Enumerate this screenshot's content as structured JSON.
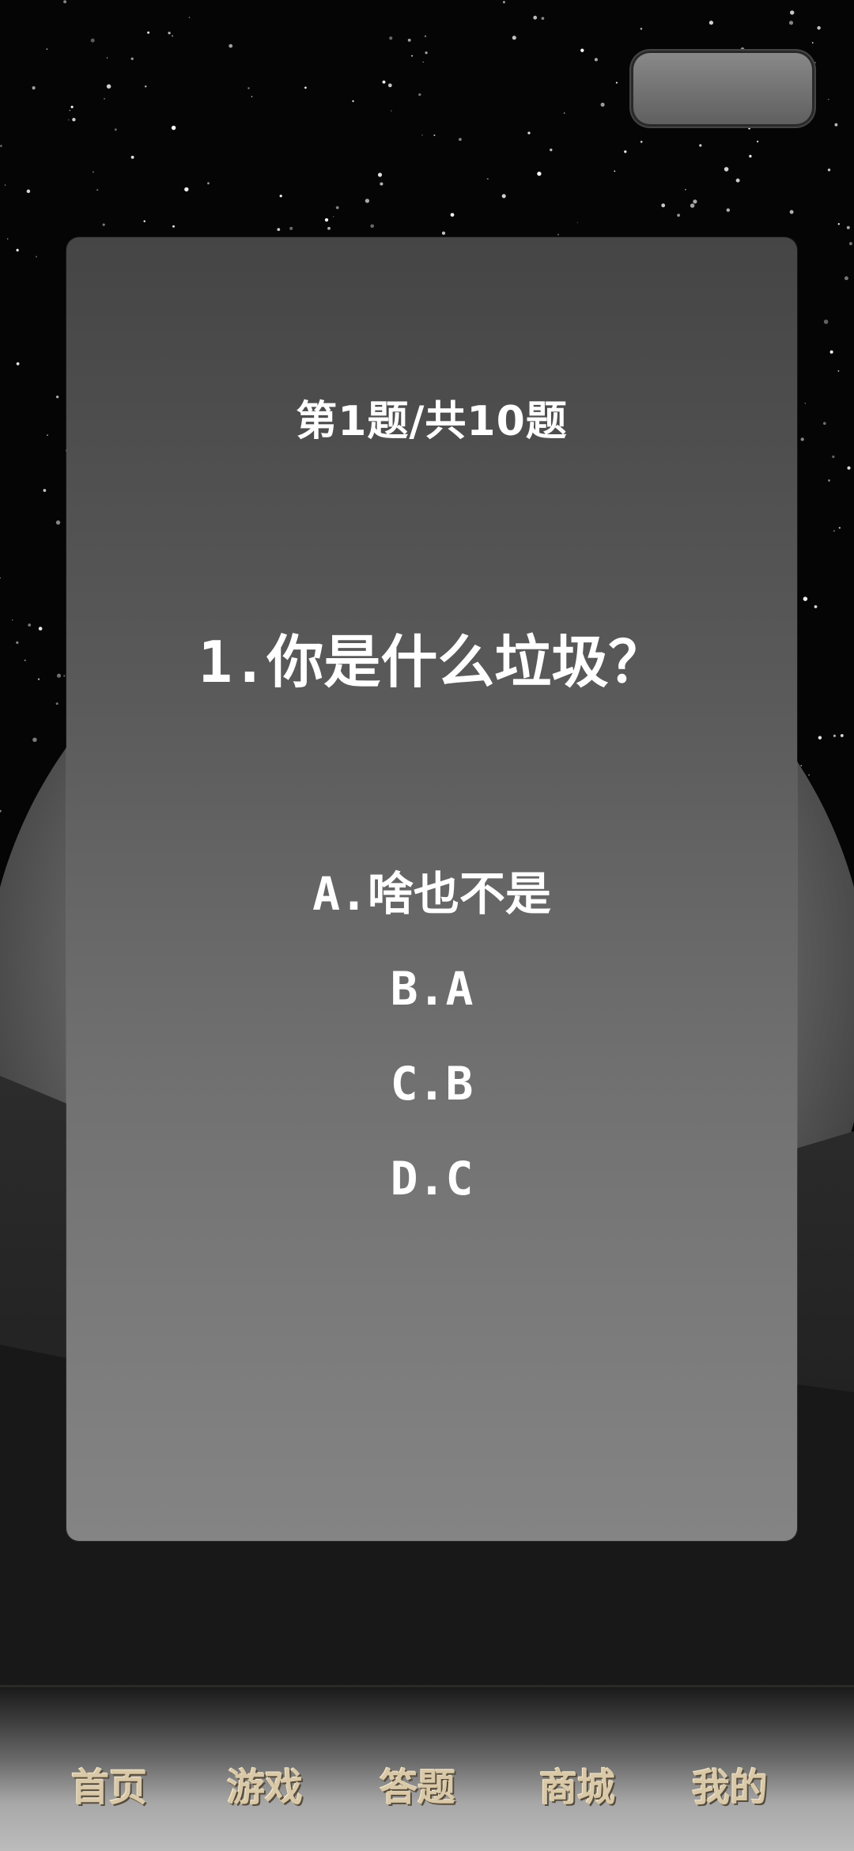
{
  "quiz": {
    "progress": "第1题/共10题",
    "question": "1.你是什么垃圾？",
    "options": [
      "A.啥也不是",
      "B.A",
      "C.B",
      "D.C"
    ]
  },
  "tabs": [
    "首页",
    "游戏",
    "答题",
    "商城",
    "我的"
  ],
  "colors": {
    "card_top": "#454545",
    "card_bottom": "#848484",
    "tab_text": "#d9c9a8"
  }
}
